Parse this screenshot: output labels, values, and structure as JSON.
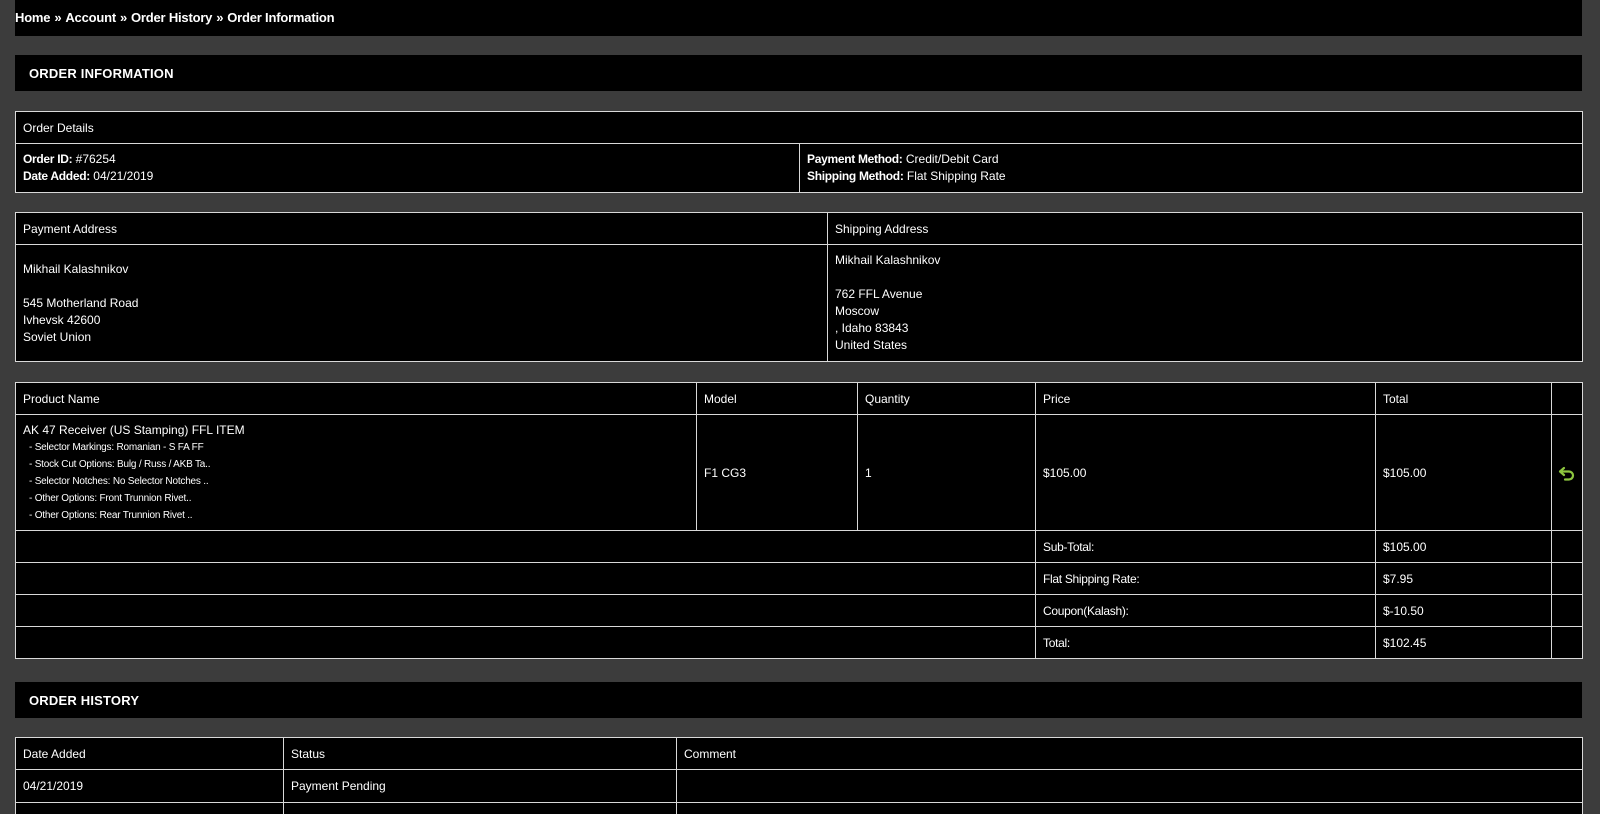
{
  "breadcrumb": {
    "items": [
      "Home",
      "Account",
      "Order History",
      "Order Information"
    ],
    "separator": "»"
  },
  "order_info": {
    "heading": "ORDER INFORMATION",
    "details_header": "Order Details",
    "order_id_label": "Order ID:",
    "order_id_value": "#76254",
    "date_added_label": "Date Added:",
    "date_added_value": "04/21/2019",
    "payment_method_label": "Payment Method:",
    "payment_method_value": "Credit/Debit Card",
    "shipping_method_label": "Shipping Method:",
    "shipping_method_value": "Flat Shipping Rate"
  },
  "addresses": {
    "payment_header": "Payment Address",
    "shipping_header": "Shipping Address",
    "payment_lines": [
      "Mikhail Kalashnikov",
      "",
      "545 Motherland Road",
      "Ivhevsk 42600",
      "Soviet Union"
    ],
    "shipping_lines": [
      "Mikhail Kalashnikov",
      "",
      "762 FFL Avenue",
      "Moscow",
      ", Idaho 83843",
      "United States"
    ]
  },
  "products": {
    "headers": {
      "name": "Product Name",
      "model": "Model",
      "quantity": "Quantity",
      "price": "Price",
      "total": "Total"
    },
    "item": {
      "name": "AK 47 Receiver (US Stamping) FFL ITEM",
      "options": [
        "- Selector Markings: Romanian - S FA FF",
        "- Stock Cut Options: Bulg / Russ / AKB Ta..",
        "- Selector Notches: No Selector Notches ..",
        "- Other Options: Front Trunnion Rivet..",
        "- Other Options: Rear Trunnion Rivet .."
      ],
      "model": "F1 CG3",
      "quantity": "1",
      "price": "$105.00",
      "total": "$105.00",
      "action_icon": "return-icon"
    },
    "totals": [
      {
        "label": "Sub-Total:",
        "value": "$105.00"
      },
      {
        "label": "Flat Shipping Rate:",
        "value": "$7.95"
      },
      {
        "label_prefix": "Coupon(",
        "label_code": "Kalash",
        "label_suffix": "):",
        "value": "$-10.50"
      },
      {
        "label": "Total:",
        "value": "$102.45"
      }
    ]
  },
  "history": {
    "heading": "ORDER HISTORY",
    "headers": {
      "date": "Date Added",
      "status": "Status",
      "comment": "Comment"
    },
    "rows": [
      {
        "date": "04/21/2019",
        "status": "Payment Pending",
        "comment": ""
      }
    ]
  },
  "colors": {
    "page_bg": "#3c3c3c",
    "panel_bg": "#000000",
    "border": "#d9d9d9",
    "icon_green": "#8dc63f"
  }
}
